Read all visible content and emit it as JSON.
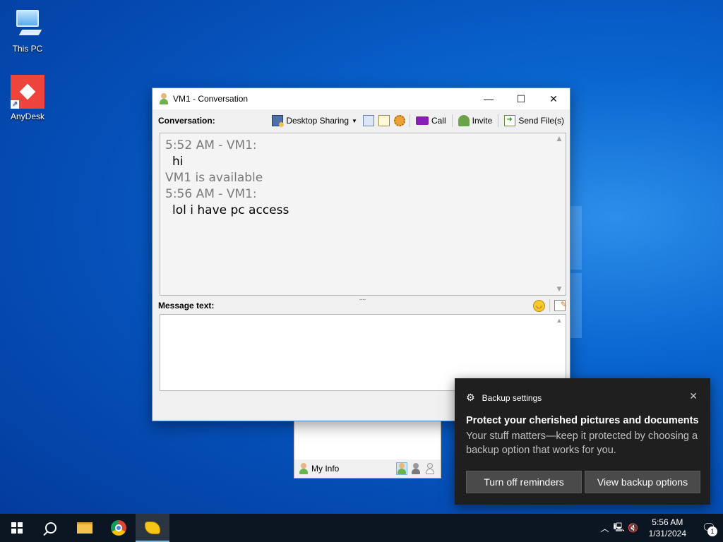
{
  "desktop": {
    "icons": [
      {
        "label": "This PC",
        "icon": "computer-icon"
      },
      {
        "label": "AnyDesk",
        "icon": "anydesk-icon"
      }
    ]
  },
  "conversation_window": {
    "title": "VM1 - Conversation",
    "controls": {
      "minimize": "—",
      "maximize": "☐",
      "close": "✕"
    },
    "toolbar": {
      "label": "Conversation:",
      "desktop_sharing": "Desktop Sharing",
      "call": "Call",
      "invite": "Invite",
      "send_files": "Send File(s)"
    },
    "history": [
      {
        "meta": "5:52 AM - VM1:",
        "text": "hi"
      },
      {
        "meta": "VM1 is available",
        "text": null
      },
      {
        "meta": "5:56 AM - VM1:",
        "text": "lol i have pc access"
      }
    ],
    "message_label": "Message text:",
    "message_value": ""
  },
  "contact_list": {
    "my_info": "My Info"
  },
  "toast": {
    "app": "Backup settings",
    "title": "Protect your cherished pictures and documents",
    "body": "Your stuff matters—keep it protected by choosing a backup option that works for you.",
    "button_1": "Turn off reminders",
    "button_2": "View backup options",
    "close": "✕"
  },
  "taskbar": {
    "time": "5:56 AM",
    "date": "1/31/2024",
    "notification_count": "1"
  },
  "colors": {
    "desktop_bg": "#0a66d0",
    "toast_bg": "#1f1f1f",
    "taskbar_bg": "#0b1622",
    "anydesk_red": "#ef443b"
  }
}
